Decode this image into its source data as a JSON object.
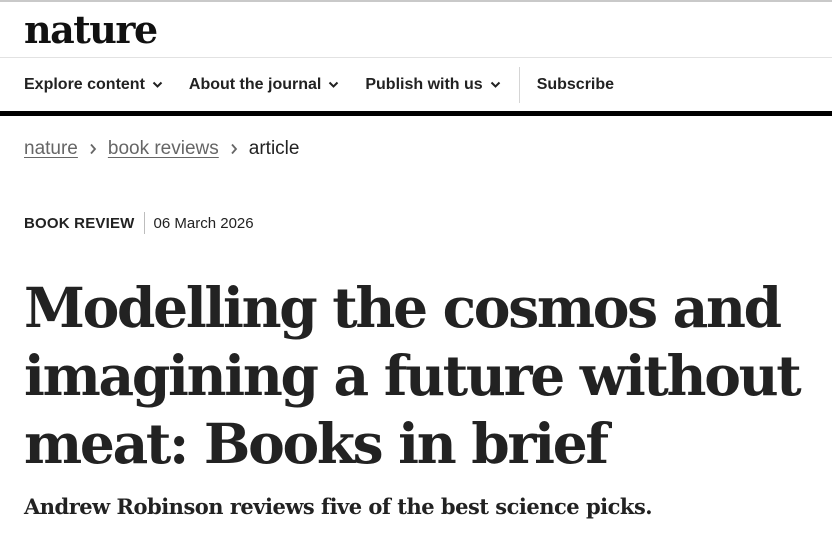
{
  "header": {
    "logo_text": "nature"
  },
  "nav": {
    "items": [
      {
        "label": "Explore content",
        "icon": "chevron-down-icon"
      },
      {
        "label": "About the journal",
        "icon": "chevron-down-icon"
      },
      {
        "label": "Publish with us",
        "icon": "chevron-down-icon"
      }
    ],
    "subscribe_label": "Subscribe"
  },
  "breadcrumb": {
    "items": [
      "nature",
      "book reviews"
    ],
    "current": "article",
    "separator_icon": "chevron-right-icon"
  },
  "article": {
    "type": "BOOK REVIEW",
    "date": "06 March 2026",
    "title": "Modelling the cosmos and imagining a future without meat: Books in brief",
    "standfirst": "Andrew Robinson reviews five of the best science picks."
  },
  "colors": {
    "text": "#222222",
    "link_gray": "#666666",
    "nav_bar_bottom": "#000000"
  }
}
